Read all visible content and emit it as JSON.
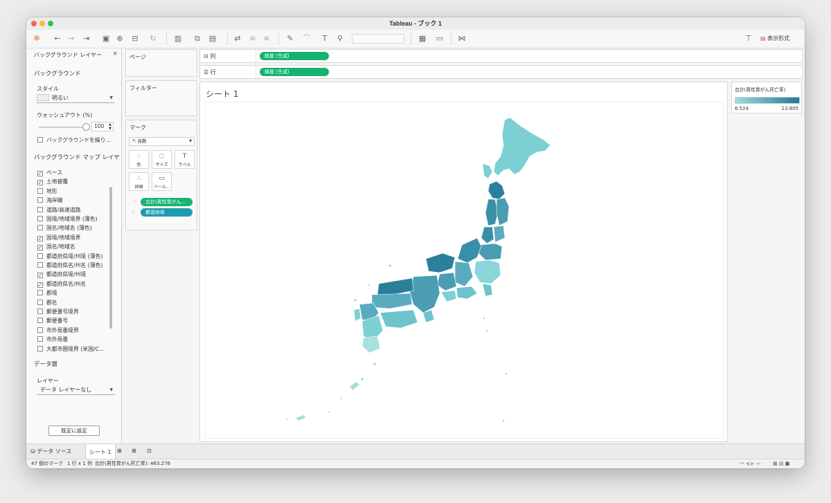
{
  "window": {
    "title": "Tableau - ブック 1"
  },
  "toolbar": {
    "show_me_label": "表示形式"
  },
  "background_panel": {
    "title": "バックグラウンド レイヤー",
    "background_heading": "バックグラウンド",
    "style_label": "スタイル",
    "style_value": "明るい",
    "washout_label": "ウォッシュアウト (%)",
    "washout_value": "100",
    "repeat_label": "バックグラウンドを繰り...",
    "map_layers_heading": "バックグラウンド マップ レイヤ",
    "layers": [
      {
        "label": "ベース",
        "checked": true
      },
      {
        "label": "土地被覆",
        "checked": true
      },
      {
        "label": "地形",
        "checked": false
      },
      {
        "label": "海岸線",
        "checked": false
      },
      {
        "label": "道路/高速道路",
        "checked": false
      },
      {
        "label": "国境/地域境界 (薄色)",
        "checked": false
      },
      {
        "label": "国名/地域名 (薄色)",
        "checked": false
      },
      {
        "label": "国境/地域境界",
        "checked": true
      },
      {
        "label": "国名/地域名",
        "checked": true
      },
      {
        "label": "都道府県境/州境 (薄色)",
        "checked": false
      },
      {
        "label": "都道府県名/州名 (薄色)",
        "checked": false
      },
      {
        "label": "都道府県境/州境",
        "checked": true
      },
      {
        "label": "都道府県名/州名",
        "checked": true
      },
      {
        "label": "郡境",
        "checked": false
      },
      {
        "label": "郡名",
        "checked": false
      },
      {
        "label": "郵便番号境界",
        "checked": false
      },
      {
        "label": "郵便番号",
        "checked": false
      },
      {
        "label": "市外局番境界",
        "checked": false
      },
      {
        "label": "市外局番",
        "checked": false
      },
      {
        "label": "大都市圏境界 (米国/C...",
        "checked": false
      }
    ],
    "data_layer_heading": "データ層",
    "layer_label": "レイヤー",
    "layer_value": "データ レイヤーなし",
    "default_button": "既定に設定"
  },
  "cards": {
    "pages": "ページ",
    "filters": "フィルター",
    "marks": "マーク",
    "mark_type": "自動",
    "buttons": {
      "color": "色",
      "size": "サイズ",
      "label": "ラベル",
      "detail": "詳細",
      "tooltip": "ツール..."
    },
    "color_pill": "合計(男性胃がん...",
    "detail_pill": "都道府県"
  },
  "shelves": {
    "columns_label": "列",
    "columns_pill": "経度 (生成)",
    "rows_label": "行",
    "rows_pill": "緯度 (生成)"
  },
  "view": {
    "title": "シート 1"
  },
  "legend": {
    "title": "合計(男性胃がん死亡率)",
    "min": "6.524",
    "max": "13.805",
    "color_low": "#9edbdc",
    "color_high": "#1f7a9a"
  },
  "tabs": {
    "datasource": "データ ソース",
    "sheet": "シート 1"
  },
  "status": {
    "marks": "47 個のマーク",
    "rows_cols": "1 行 x 1 列",
    "sum": "合計(男性胃がん死亡率): 463.276"
  },
  "colors": {
    "pill_green": "#15b371",
    "pill_teal": "#1b9cb0",
    "map_light": "#7ccfd3",
    "map_dark": "#2b7f9b"
  }
}
